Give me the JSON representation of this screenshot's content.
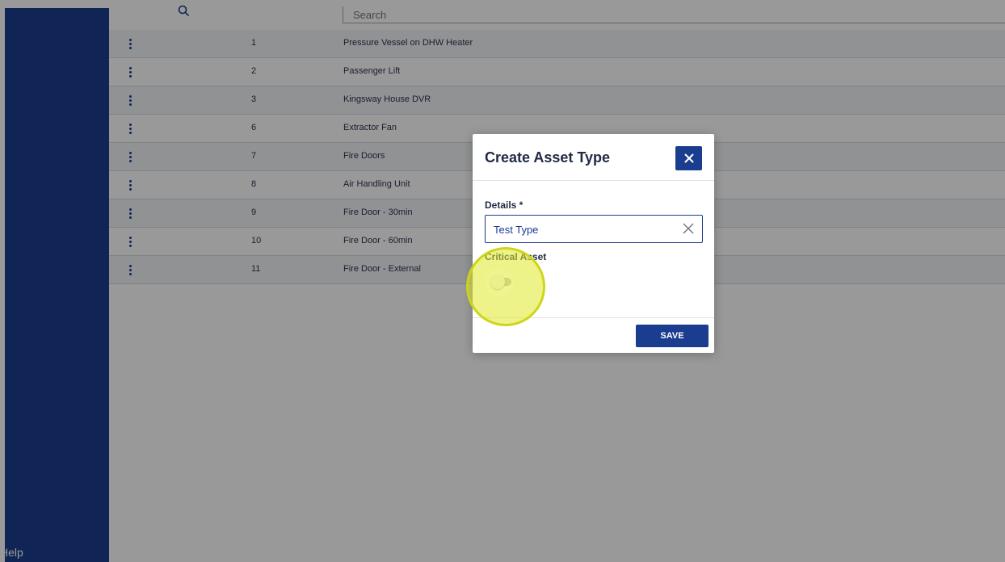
{
  "search": {
    "placeholder": "Search"
  },
  "rows": [
    {
      "id": "1",
      "name": "Pressure Vessel on DHW Heater"
    },
    {
      "id": "2",
      "name": "Passenger Lift"
    },
    {
      "id": "3",
      "name": "Kingsway House DVR"
    },
    {
      "id": "6",
      "name": "Extractor Fan"
    },
    {
      "id": "7",
      "name": "Fire Doors"
    },
    {
      "id": "8",
      "name": "Air Handling Unit"
    },
    {
      "id": "9",
      "name": "Fire Door - 30min"
    },
    {
      "id": "10",
      "name": "Fire Door - 60min"
    },
    {
      "id": "11",
      "name": "Fire Door - External"
    }
  ],
  "sidebar": {
    "help_label": "Help"
  },
  "modal": {
    "title": "Create Asset Type",
    "details_label": "Details *",
    "details_value": "Test Type",
    "critical_label": "Critical Asset",
    "critical_on": false,
    "save_label": "SAVE"
  },
  "colors": {
    "brand": "#1b3d8f",
    "highlight": "#dfe828"
  }
}
